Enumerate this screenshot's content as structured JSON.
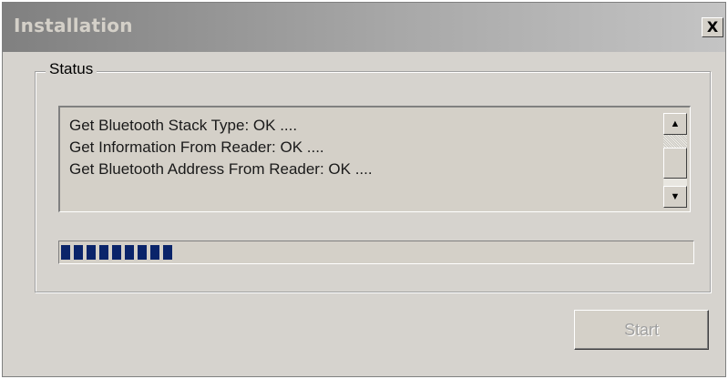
{
  "window": {
    "title": "Installation",
    "close_glyph": "X"
  },
  "status_group": {
    "label": "Status",
    "log_lines": [
      "Get Bluetooth Stack Type: OK ....",
      "Get Information From Reader: OK ....",
      "Get Bluetooth Address From Reader: OK ...."
    ],
    "scrollbar": {
      "up_glyph": "▲",
      "down_glyph": "▼"
    },
    "progress": {
      "filled_blocks": 9,
      "color": "#0a246a"
    }
  },
  "buttons": {
    "start_label": "Start",
    "start_enabled": false
  },
  "colors": {
    "dialog_bg": "#d6d3ce",
    "progress_fill": "#0a246a",
    "disabled_text": "#a0a0a0"
  },
  "icons": {
    "close": "close-icon",
    "scroll_up": "arrow-up-icon",
    "scroll_down": "arrow-down-icon"
  }
}
